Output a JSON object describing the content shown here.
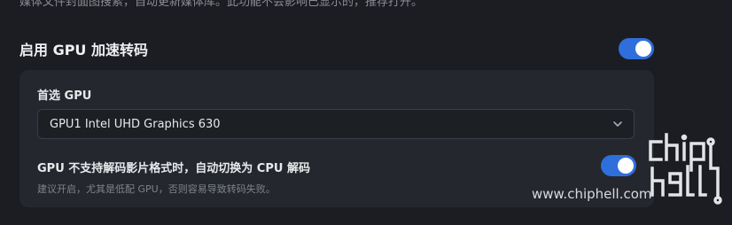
{
  "top_text": "媒体文件封面图搜索，自动更新媒体库。此功能不会影响已显示的，推荐打开。",
  "gpu_section": {
    "title": "启用 GPU 加速转码",
    "enabled": true
  },
  "preferred_gpu": {
    "label": "首选 GPU",
    "selected": "GPU1 Intel UHD Graphics 630"
  },
  "fallback": {
    "label": "GPU 不支持解码影片格式时，自动切换为 CPU 解码",
    "hint": "建议开启，尤其是低配 GPU，否则容易导致转码失败。",
    "enabled": true
  },
  "watermark": {
    "url": "www.chiphell.com",
    "logo_text": "chip hell"
  },
  "colors": {
    "background": "#1b1d22",
    "panel": "#24272d",
    "accent": "#2f6fdb"
  }
}
